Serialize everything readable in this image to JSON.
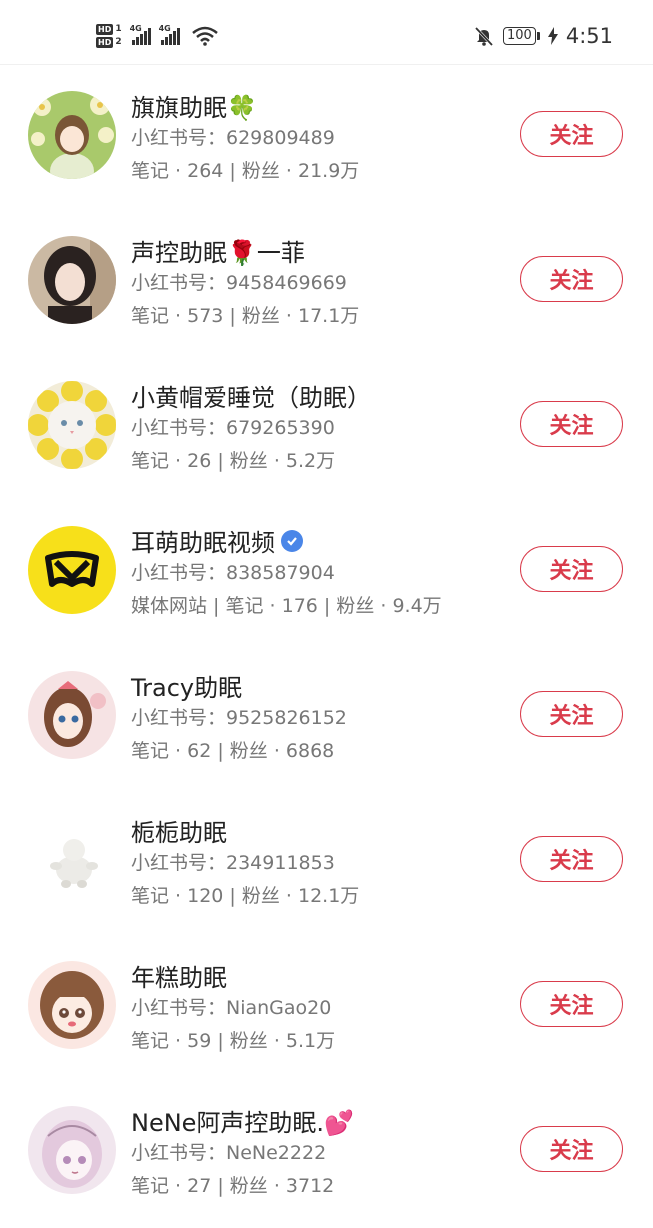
{
  "status_bar": {
    "hd1": "HD",
    "hd1_num": "1",
    "hd2": "HD",
    "hd2_num": "2",
    "net1": "4G",
    "net2": "4G",
    "battery": "100",
    "time": "4:51",
    "icons": [
      "signal-icon",
      "wifi-icon",
      "mute-bell-icon",
      "battery-icon",
      "charging-icon"
    ]
  },
  "follow_label": "关注",
  "users": [
    {
      "name": "旗旗助眠🍀",
      "id_line": "小红书号：629809489",
      "stats": "笔记 · 264 | 粉丝 · 21.9万",
      "avatar": "avatar-girl-flowers"
    },
    {
      "name": "声控助眠🌹一菲",
      "id_line": "小红书号：9458469669",
      "stats": "笔记 · 573 | 粉丝 · 17.1万",
      "avatar": "avatar-girl-photo"
    },
    {
      "name": "小黄帽爱睡觉（助眠）",
      "id_line": "小红书号：679265390",
      "stats": "笔记 · 26 | 粉丝 · 5.2万",
      "avatar": "avatar-cat-sunflower"
    },
    {
      "name": "耳萌助眠视频",
      "verified": true,
      "id_line": "小红书号：838587904",
      "stats": "媒体网站 | 笔记 · 176 | 粉丝 · 9.4万",
      "avatar": "avatar-logo-yellow"
    },
    {
      "name": "Tracy助眠",
      "id_line": "小红书号：9525826152",
      "stats": "笔记 · 62 | 粉丝 · 6868",
      "avatar": "avatar-cartoon-girl"
    },
    {
      "name": "栀栀助眠",
      "id_line": "小红书号：234911853",
      "stats": "笔记 · 120 | 粉丝 · 12.1万",
      "avatar": "avatar-white-plush"
    },
    {
      "name": "年糕助眠",
      "id_line": "小红书号：NianGao20",
      "stats": "笔记 · 59 | 粉丝 · 5.1万",
      "avatar": "avatar-anime-girl"
    },
    {
      "name": "NeNe阿声控助眠.💕",
      "id_line": "小红书号：NeNe2222",
      "stats": "笔记 · 27 | 粉丝 · 3712",
      "avatar": "avatar-sketch-girl"
    }
  ]
}
